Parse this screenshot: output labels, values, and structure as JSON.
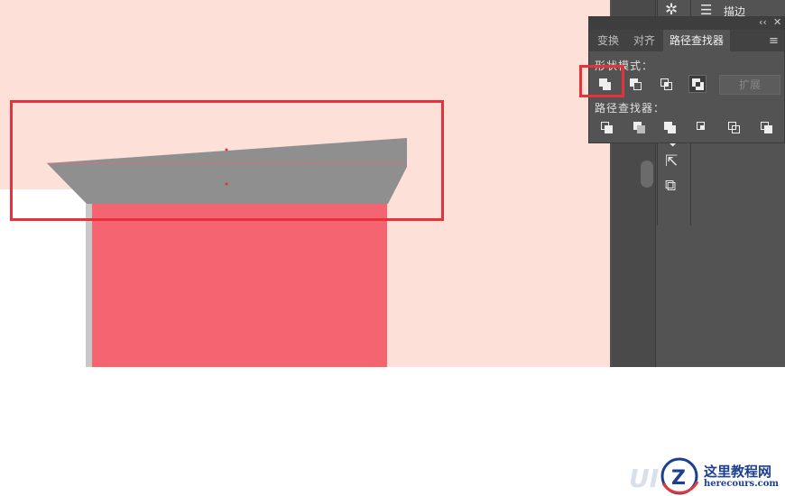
{
  "panel": {
    "tabs": [
      {
        "label": "变换"
      },
      {
        "label": "对齐"
      },
      {
        "label": "路径查找器"
      }
    ],
    "shape_modes_label": "形状模式：",
    "pathfinders_label": "路径查找器：",
    "expand_label": "扩展",
    "shape_mode_buttons": [
      "unite",
      "minus-front",
      "intersect",
      "exclude"
    ],
    "pathfinder_buttons": [
      "divide",
      "trim",
      "merge",
      "crop",
      "outline",
      "minus-back"
    ]
  },
  "dock": {
    "stroke_label": "描边"
  },
  "watermark": {
    "title": "这里教程网",
    "url": "herecours.com"
  },
  "colors": {
    "canvas_bg": "#fde0d7",
    "red_block": "#f46571",
    "gray_shape": "#8f8f8f",
    "highlight": "#e8313a",
    "panel_bg": "#535353"
  }
}
